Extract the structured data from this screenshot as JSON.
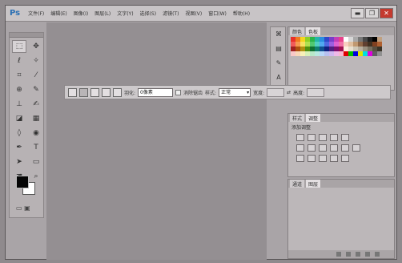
{
  "app": {
    "logo": "Ps"
  },
  "menu": [
    {
      "label": "文件(F)"
    },
    {
      "label": "编辑(E)"
    },
    {
      "label": "图像(I)"
    },
    {
      "label": "图层(L)"
    },
    {
      "label": "文字(Y)"
    },
    {
      "label": "选择(S)"
    },
    {
      "label": "滤镜(T)"
    },
    {
      "label": "视图(V)"
    },
    {
      "label": "窗口(W)"
    },
    {
      "label": "帮助(H)"
    }
  ],
  "window_controls": {
    "minimize": "▬",
    "restore": "❐",
    "close": "✕"
  },
  "tools": [
    {
      "icon": "marquee-icon",
      "glyph": "⬚",
      "active": true
    },
    {
      "icon": "move-icon",
      "glyph": "✥"
    },
    {
      "icon": "lasso-icon",
      "glyph": "ℓ"
    },
    {
      "icon": "magic-wand-icon",
      "glyph": "✧"
    },
    {
      "icon": "crop-icon",
      "glyph": "⌗"
    },
    {
      "icon": "eyedropper-icon",
      "glyph": "⁄"
    },
    {
      "icon": "healing-icon",
      "glyph": "⊕"
    },
    {
      "icon": "brush-icon",
      "glyph": "✎"
    },
    {
      "icon": "stamp-icon",
      "glyph": "⊥"
    },
    {
      "icon": "history-brush-icon",
      "glyph": "✍"
    },
    {
      "icon": "eraser-icon",
      "glyph": "◪"
    },
    {
      "icon": "gradient-icon",
      "glyph": "▦"
    },
    {
      "icon": "blur-icon",
      "glyph": "◊"
    },
    {
      "icon": "dodge-icon",
      "glyph": "◉"
    },
    {
      "icon": "pen-icon",
      "glyph": "✒"
    },
    {
      "icon": "type-icon",
      "glyph": "T"
    },
    {
      "icon": "path-select-icon",
      "glyph": "➤"
    },
    {
      "icon": "shape-icon",
      "glyph": "▭"
    },
    {
      "icon": "hand-icon",
      "glyph": "☚"
    },
    {
      "icon": "zoom-icon",
      "glyph": "⌕"
    }
  ],
  "options": {
    "feather_label": "羽化:",
    "feather_value": "0像素",
    "antialias_label": "消除锯齿",
    "style_label": "样式:",
    "style_value": "正常",
    "width_label": "宽度:",
    "height_label": "高度:"
  },
  "swatches_panel": {
    "tabs": [
      "颜色",
      "色板"
    ]
  },
  "swatch_colors": [
    "#e8302a",
    "#f07a20",
    "#f5d51e",
    "#8fd025",
    "#2bb54a",
    "#24b7a8",
    "#2a8ee0",
    "#2f49c9",
    "#7a3ec9",
    "#c23fb8",
    "#e8418a",
    "#ffffff",
    "#d8d8d8",
    "#a8a8a8",
    "#787878",
    "#484848",
    "#202020",
    "#000000",
    "#c0a080",
    "#f05a5a",
    "#f59a50",
    "#f8e060",
    "#b0e050",
    "#50c870",
    "#50cfc0",
    "#50a8f0",
    "#5068e0",
    "#9a60e0",
    "#e060d0",
    "#f070a8",
    "#f8d0c0",
    "#e0c0a0",
    "#c09870",
    "#906848",
    "#604030",
    "#403020",
    "#804020",
    "#b06030",
    "#a02020",
    "#b05010",
    "#b09010",
    "#509010",
    "#107030",
    "#108070",
    "#105090",
    "#102080",
    "#502080",
    "#801070",
    "#a01050",
    "#fff0e0",
    "#e8e0d0",
    "#d0c8b8",
    "#b8b0a0",
    "#98907f",
    "#787060",
    "#584f40",
    "#3a3428",
    "#f8c8c8",
    "#f8d8b8",
    "#f8f0b8",
    "#d8f0b8",
    "#b8e8c8",
    "#b8e8e0",
    "#b8d8f8",
    "#b8c0f0",
    "#d0b8f0",
    "#f0b8e8",
    "#f8b8d0",
    "#e00000",
    "#00c000",
    "#0000e0",
    "#e0e000",
    "#00e0e0",
    "#e000e0",
    "#606060",
    "#909090"
  ],
  "styles_panel": {
    "tabs": [
      "样式",
      "调整"
    ],
    "subtitle": "添加调整"
  },
  "layers_panel": {
    "tabs": [
      "通道",
      "图层"
    ]
  }
}
